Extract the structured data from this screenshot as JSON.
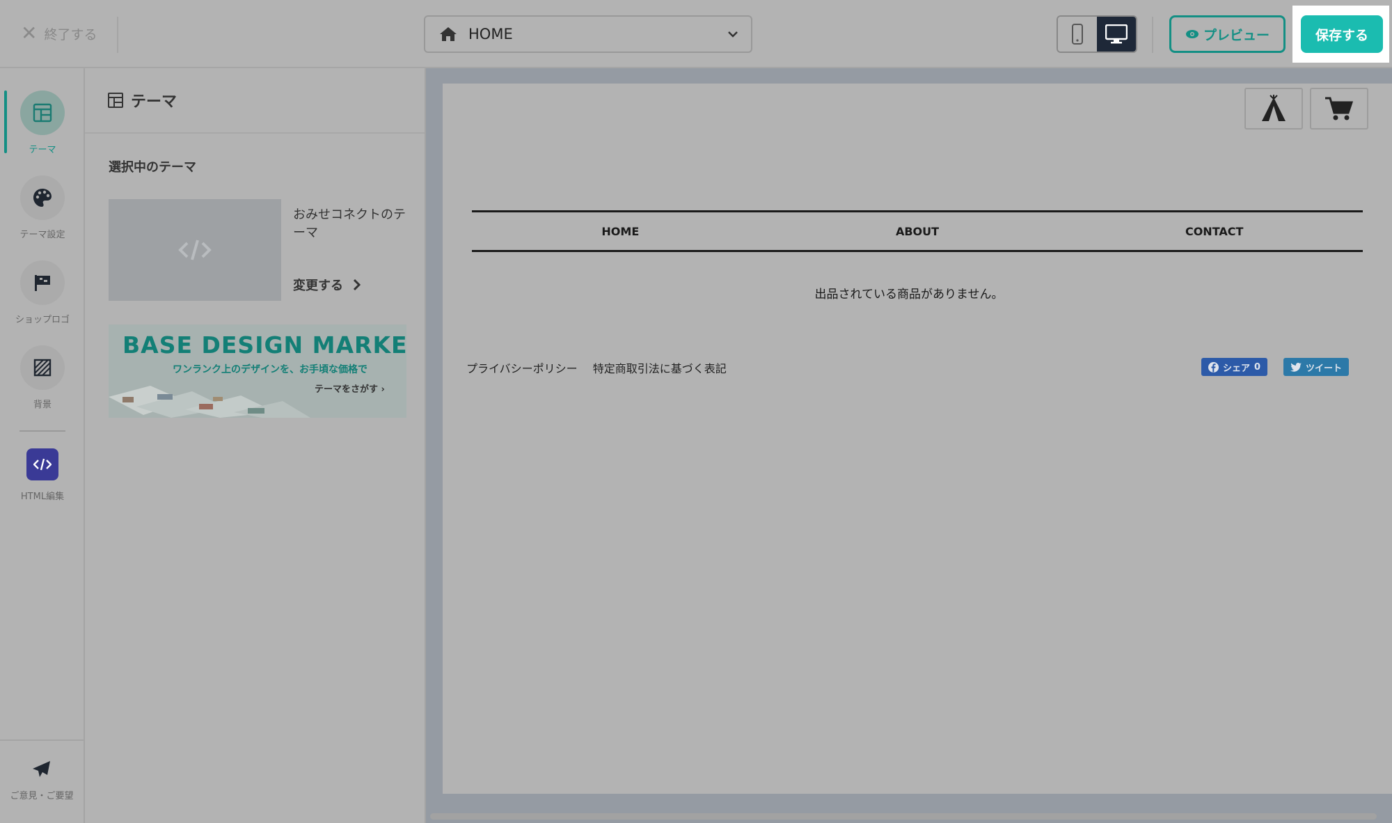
{
  "header": {
    "exit_label": "終了する",
    "page_select": {
      "value": "HOME"
    },
    "preview_label": "プレビュー",
    "save_label": "保存する"
  },
  "rail": {
    "items": [
      {
        "label": "テーマ",
        "icon": "layout-icon",
        "active": true
      },
      {
        "label": "テーマ設定",
        "icon": "palette-icon"
      },
      {
        "label": "ショップロゴ",
        "icon": "flag-icon"
      },
      {
        "label": "背景",
        "icon": "background-icon"
      },
      {
        "label": "HTML編集",
        "icon": "code-icon"
      }
    ],
    "feedback_label": "ご意見・ご要望"
  },
  "panel": {
    "title": "テーマ",
    "section_title": "選択中のテーマ",
    "theme_name": "おみせコネクトのテーマ",
    "change_label": "変更する",
    "banner": {
      "title": "BASE DESIGN MARKET",
      "subtitle": "ワンランク上のデザインを、お手頃な価格で",
      "link": "テーマをさがす"
    }
  },
  "preview": {
    "nav": [
      "HOME",
      "ABOUT",
      "CONTACT"
    ],
    "empty_message": "出品されている商品がありません。",
    "footer_links": [
      "プライバシーポリシー",
      "特定商取引法に基づく表記"
    ],
    "share": {
      "facebook_label": "シェア",
      "facebook_count": "0",
      "tweet_label": "ツイート"
    }
  },
  "colors": {
    "accent": "#1bbcb0",
    "accent_dark": "#138f84",
    "device_active": "#1e2838",
    "html_badge": "#3a3a96"
  }
}
